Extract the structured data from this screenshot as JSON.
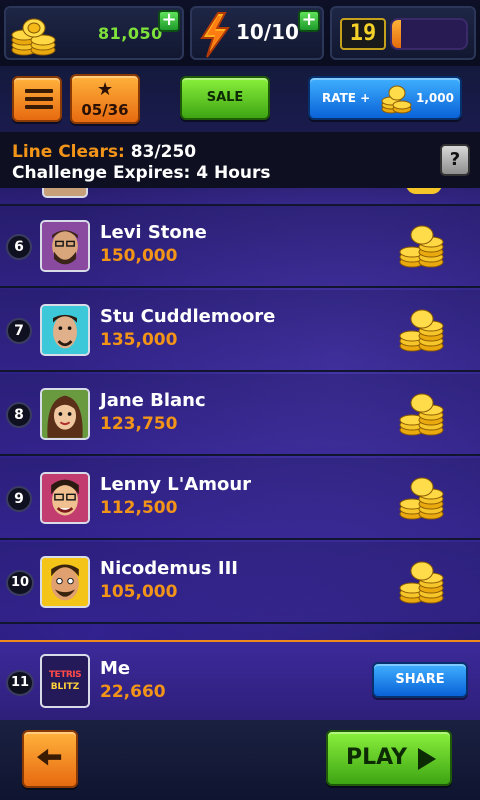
{
  "hud": {
    "coins": "81,050",
    "energy": "10/10",
    "level": "19",
    "xp_fraction": 0.12
  },
  "toolbar": {
    "stars": "05/36",
    "sale_label": "SALE",
    "rate_label": "RATE +",
    "rate_amount": "1,000"
  },
  "challenge": {
    "line_clears_label": "Line Clears:",
    "line_clears_value": "83/250",
    "expires_text": "Challenge Expires: 4 Hours",
    "help_label": "?"
  },
  "leaderboard": {
    "rows": [
      {
        "rank": "6",
        "name": "Levi Stone",
        "score": "150,000"
      },
      {
        "rank": "7",
        "name": "Stu Cuddlemoore",
        "score": "135,000"
      },
      {
        "rank": "8",
        "name": "Jane Blanc",
        "score": "123,750"
      },
      {
        "rank": "9",
        "name": "Lenny L'Amour",
        "score": "112,500"
      },
      {
        "rank": "10",
        "name": "Nicodemus III",
        "score": "105,000"
      }
    ],
    "me": {
      "rank": "11",
      "name": "Me",
      "score": "22,660",
      "share_label": "SHARE",
      "logo_top": "TETRIS",
      "logo_bottom": "BLITZ"
    }
  },
  "bottom": {
    "play_label": "PLAY"
  },
  "colors": {
    "accent_orange": "#f29418",
    "green": "#7ee23a",
    "blue": "#0a62d8"
  },
  "icons": {
    "coins": "coin-stack-icon",
    "energy": "lightning-bolt-icon",
    "menu": "hamburger-menu-icon",
    "star": "star-icon",
    "back": "back-arrow-icon",
    "play": "play-triangle-icon"
  }
}
